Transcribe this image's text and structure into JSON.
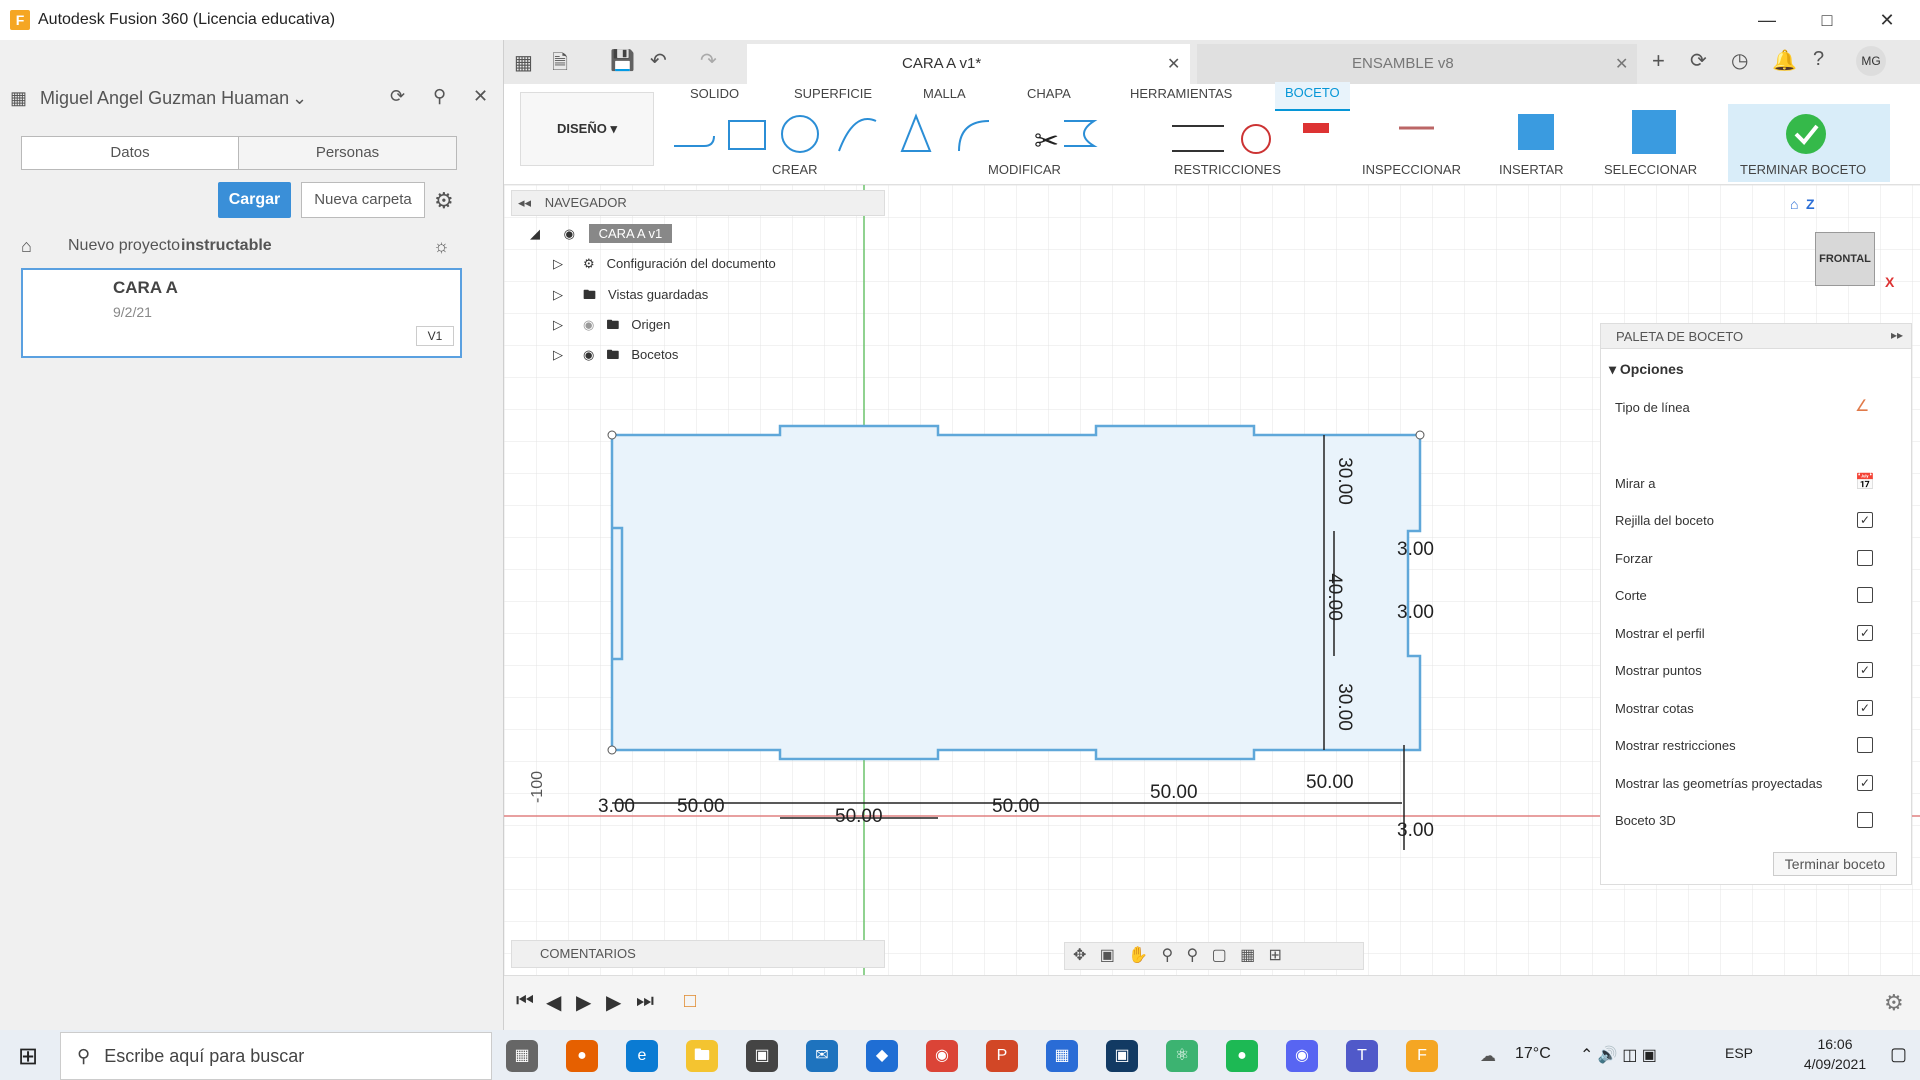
{
  "window": {
    "title": "Autodesk Fusion 360 (Licencia educativa)",
    "app_icon": "F"
  },
  "data_panel": {
    "user": "Miguel Angel Guzman Huaman",
    "tabs": [
      "Datos",
      "Personas"
    ],
    "upload_button": "Cargar",
    "new_folder_button": "Nueva carpeta",
    "breadcrumb": [
      "Nuevo proyecto",
      "instructable"
    ],
    "file": {
      "name": "CARA A",
      "date": "9/2/21",
      "version": "V1"
    }
  },
  "tabs": [
    {
      "label": "CARA A v1*",
      "active": true
    },
    {
      "label": "ENSAMBLE v8",
      "active": false
    }
  ],
  "toolbar": {
    "workspace": "DISEÑO",
    "menu_tabs": [
      "SOLIDO",
      "SUPERFICIE",
      "MALLA",
      "CHAPA",
      "HERRAMIENTAS",
      "BOCETO"
    ],
    "active_tab": "BOCETO",
    "groups": [
      "CREAR",
      "MODIFICAR",
      "RESTRICCIONES",
      "INSPECCIONAR",
      "INSERTAR",
      "SELECCIONAR",
      "TERMINAR BOCETO"
    ]
  },
  "navigator": {
    "title": "NAVEGADOR",
    "root": "CARA A v1",
    "items": [
      "Configuración del documento",
      "Vistas guardadas",
      "Origen",
      "Bocetos"
    ]
  },
  "viewcube": {
    "face": "FRONTAL",
    "axis_z": "Z",
    "axis_x": "X"
  },
  "palette": {
    "title": "PALETA DE BOCETO",
    "section": "Opciones",
    "rows": [
      {
        "label": "Tipo de línea",
        "type": "icon"
      },
      {
        "label": "Mirar a",
        "type": "icon"
      },
      {
        "label": "Rejilla del boceto",
        "checked": true
      },
      {
        "label": "Forzar",
        "checked": false
      },
      {
        "label": "Corte",
        "checked": false
      },
      {
        "label": "Mostrar el perfil",
        "checked": true
      },
      {
        "label": "Mostrar puntos",
        "checked": true
      },
      {
        "label": "Mostrar cotas",
        "checked": true
      },
      {
        "label": "Mostrar restricciones",
        "checked": false
      },
      {
        "label": "Mostrar las geometrías proyectadas",
        "checked": true
      },
      {
        "label": "Boceto 3D",
        "checked": false
      }
    ],
    "finish_button": "Terminar boceto"
  },
  "comments": {
    "title": "COMENTARIOS"
  },
  "dimensions": {
    "d300": "3.00",
    "d5000": "50.00",
    "d3000": "30.00",
    "d4000": "40.00",
    "axis": "-100"
  },
  "taskbar": {
    "search_placeholder": "Escribe aquí para buscar",
    "temperature": "17°C",
    "language": "ESP",
    "time": "16:06",
    "date": "4/09/2021"
  },
  "colors": {
    "accent": "#0696d7",
    "sketch_fill": "#e9f3fb",
    "sketch_line": "#5fa7d9",
    "finish_green": "#35b94a"
  }
}
